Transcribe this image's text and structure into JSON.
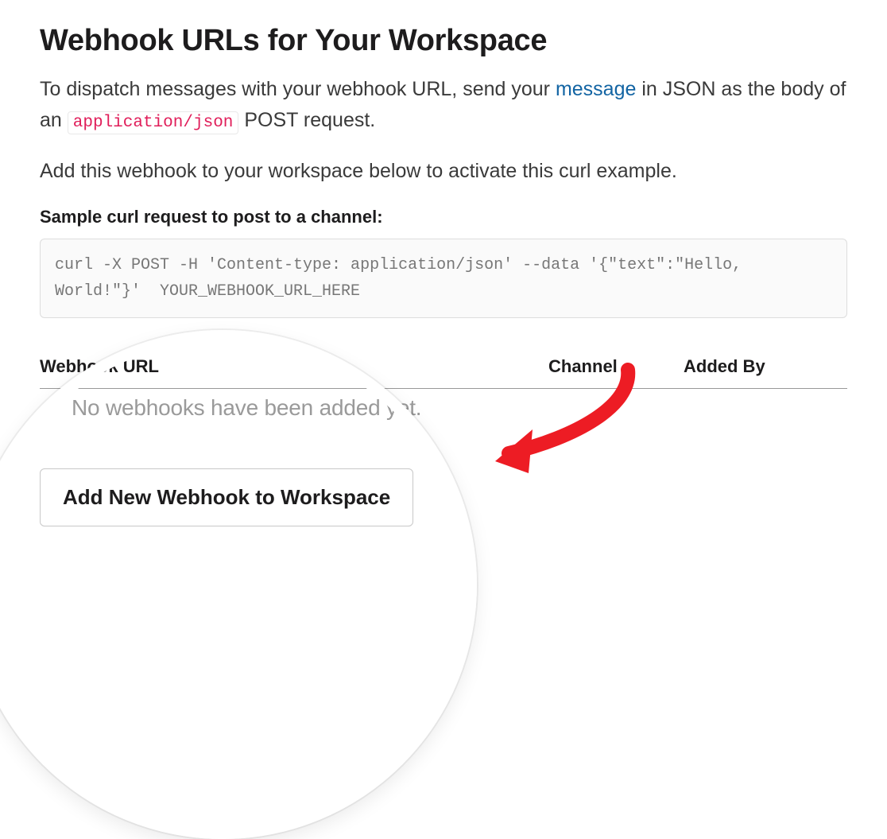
{
  "heading": "Webhook URLs for Your Workspace",
  "intro_before_link": "To dispatch messages with your webhook URL, send your ",
  "intro_link": "message",
  "intro_after_link": " in JSON as the body of an ",
  "intro_code": "application/json",
  "intro_tail": " POST request.",
  "para2": "Add this webhook to your workspace below to activate this curl example.",
  "sample_label": "Sample curl request to post to a channel:",
  "curl_code": "curl -X POST -H 'Content-type: application/json' --data '{\"text\":\"Hello, World!\"}'  YOUR_WEBHOOK_URL_HERE",
  "table": {
    "col_url": "Webhook URL",
    "col_channel": "Channel",
    "col_added": "Added By",
    "empty": "No webhooks have been added yet."
  },
  "add_button": "Add New Webhook to Workspace"
}
